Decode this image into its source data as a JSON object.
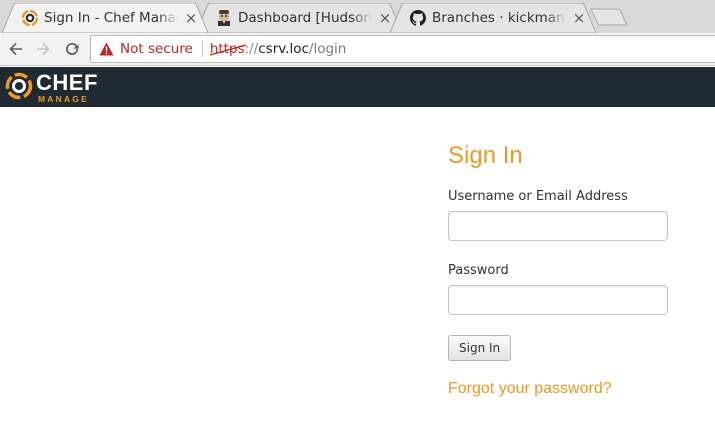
{
  "browser": {
    "tabs": [
      {
        "title": "Sign In - Chef Manage",
        "favicon": "chef-favicon",
        "active": true
      },
      {
        "title": "Dashboard [Hudson]",
        "favicon": "jenkins-butler-favicon",
        "active": false
      },
      {
        "title": "Branches · kickman",
        "favicon": "github-octocat-favicon",
        "active": false
      }
    ],
    "tab_close_glyph": "×",
    "address": {
      "security_text": "Not secure",
      "scheme": "https",
      "separator": "://",
      "host": "csrv.loc",
      "path": "/login"
    }
  },
  "app": {
    "brand_name": "CHEF",
    "brand_sub": "MANAGE",
    "brand_color": "#f09820",
    "header_color": "#1f2a33"
  },
  "signin": {
    "title": "Sign In",
    "username_label": "Username or Email Address",
    "username_value": "",
    "password_label": "Password",
    "password_value": "",
    "submit_label": "Sign In",
    "forgot_link": "Forgot your password?"
  }
}
